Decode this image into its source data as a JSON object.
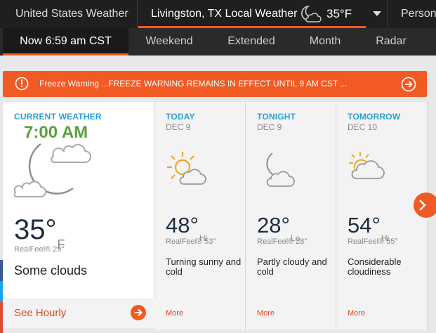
{
  "topbar": {
    "site_title": "United States Weather",
    "location": "Livingston, TX Local Weather",
    "location_temp": "35°F",
    "location_icon": "moon-cloud-icon",
    "person_label": "Person"
  },
  "subnav": {
    "tabs": [
      {
        "label": "Now 6:59 am CST",
        "active": true
      },
      {
        "label": "Weekend",
        "active": false
      },
      {
        "label": "Extended",
        "active": false
      },
      {
        "label": "Month",
        "active": false
      },
      {
        "label": "Radar",
        "active": false
      }
    ]
  },
  "warning": {
    "text": "Freeze Warning ...FREEZE WARNING REMAINS IN EFFECT UNTIL 9 AM CST ...",
    "icon": "alert-circle-icon",
    "arrow_icon": "arrow-right-circle-icon",
    "color": "#f15a22"
  },
  "current": {
    "heading": "CURRENT WEATHER",
    "time": "7:00 AM",
    "temp": "35°",
    "unit": "F",
    "realfeel": "RealFeel® 29°",
    "condition": "Some clouds",
    "hourly_label": "See Hourly",
    "icon": "moon-clouds-icon"
  },
  "forecast": [
    {
      "heading": "TODAY",
      "date": "DEC 9",
      "temp": "48°",
      "hilo": "Hi",
      "realfeel": "RealFeel® 53°",
      "condition": "Turning sunny and cold",
      "more": "More",
      "icon": "sun-cloud-icon"
    },
    {
      "heading": "TONIGHT",
      "date": "DEC 9",
      "temp": "28°",
      "hilo": "Lo",
      "realfeel": "RealFeel® 28°",
      "condition": "Partly cloudy and cold",
      "more": "More",
      "icon": "moon-cloud-icon"
    },
    {
      "heading": "TOMORROW",
      "date": "DEC 10",
      "temp": "54°",
      "hilo": "Hi",
      "realfeel": "RealFeel® 55°",
      "condition": "Considerable cloudiness",
      "more": "More",
      "icon": "sun-cloud-icon"
    }
  ],
  "colors": {
    "accent": "#f15a22",
    "heading_blue": "#2a9fd6",
    "time_green": "#5aa03c",
    "topbar": "#1f1f1f"
  }
}
